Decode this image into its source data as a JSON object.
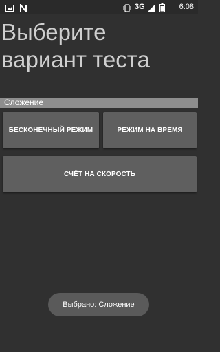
{
  "status_bar": {
    "time": "6:08",
    "network": "3G",
    "icons": [
      "image-icon",
      "n-app-icon",
      "vibrate-icon",
      "signal-icon",
      "battery-icon"
    ]
  },
  "title": "Выберите\nвариант теста",
  "section": {
    "label": "Сложение"
  },
  "buttons": {
    "endless": "БЕСКОНЕЧНЫЙ РЕЖИМ",
    "timed": "РЕЖИМ НА ВРЕМЯ",
    "speed": "СЧЁТ НА СКОРОСТЬ"
  },
  "toast": {
    "text": "Выбрано: Сложение"
  },
  "colors": {
    "background": "#303030",
    "title_text": "#cfcfcf",
    "section_bg": "#8e8e8e",
    "button_bg": "#5f5f5f",
    "toast_bg": "#5a5a5a"
  }
}
